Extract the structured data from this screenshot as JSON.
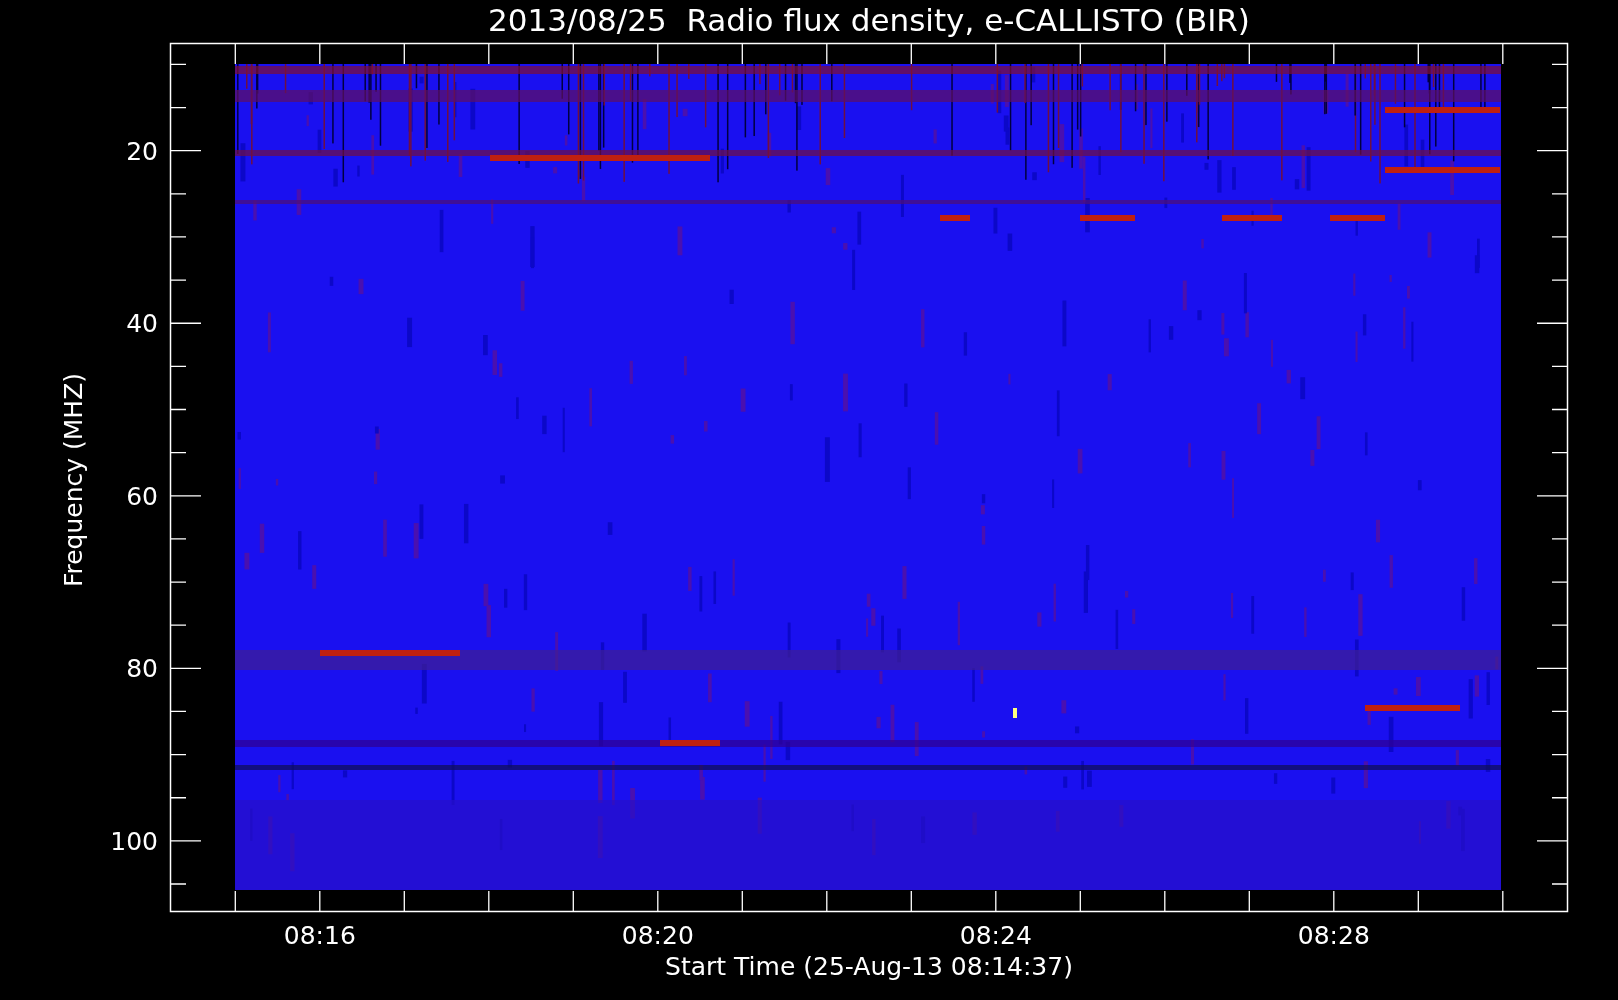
{
  "title": "2013/08/25  Radio flux density, e-CALLISTO (BIR)",
  "plot": {
    "ylabel": "Frequency (MHZ)",
    "xlabel": "Start Time (25-Aug-13 08:14:37)",
    "yticks": [
      "20",
      "40",
      "60",
      "80",
      "100"
    ],
    "xticks": [
      "08:16",
      "08:20",
      "08:24",
      "08:28"
    ]
  }
}
